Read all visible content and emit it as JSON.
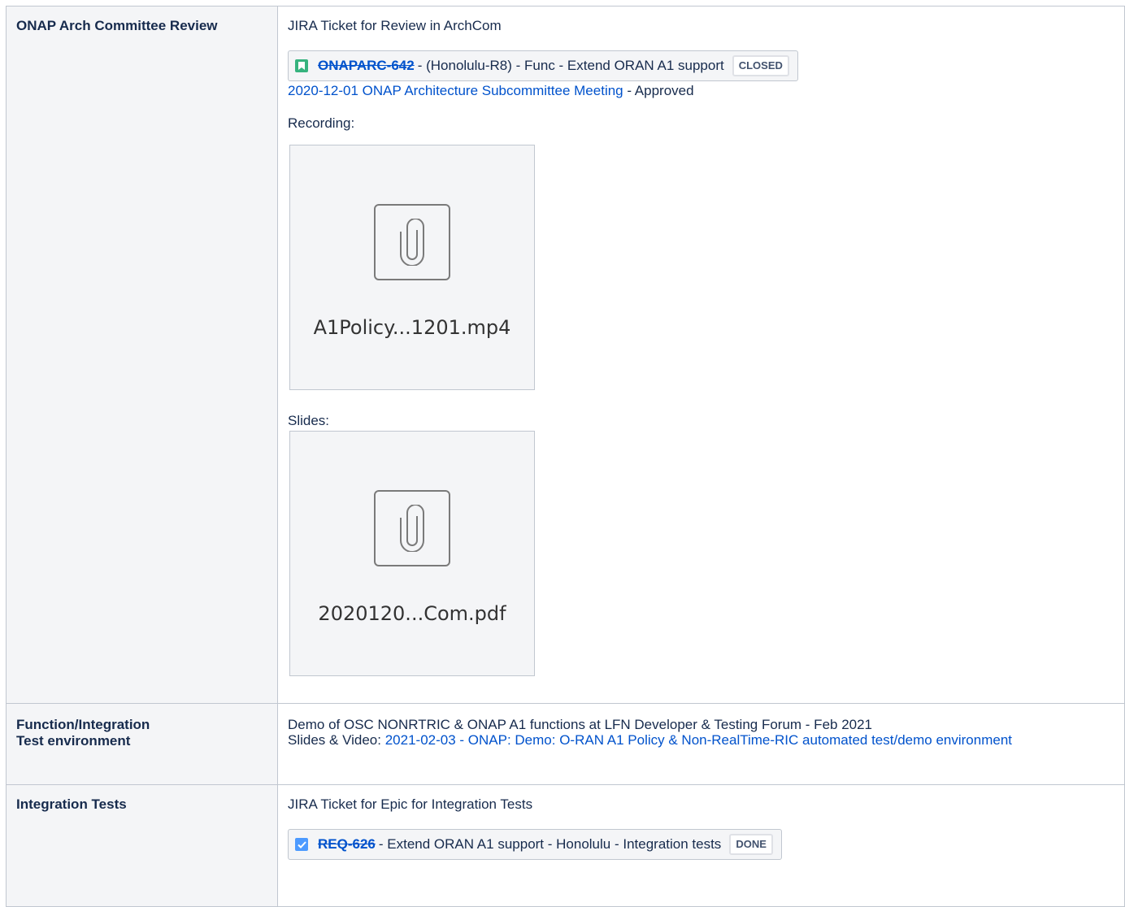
{
  "rows": [
    {
      "label": "ONAP Arch Committee Review",
      "intro": "JIRA Ticket for Review in ArchCom",
      "ticket": {
        "key": "ONAPARC-642",
        "summary": "- (Honolulu-R8) - Func - Extend ORAN A1 support",
        "status": "CLOSED",
        "type_icon": "story-icon",
        "type_color": "#36b37e"
      },
      "meeting_link": "2020-12-01 ONAP Architecture Subcommittee Meeting",
      "meeting_suffix": " - Approved",
      "recording_label": "Recording:",
      "recording_file": "A1Policy...1201.mp4",
      "slides_label": "Slides:",
      "slides_file": "2020120...Com.pdf"
    },
    {
      "label_line1": "Function/Integration",
      "label_line2": "Test environment",
      "demo_text": "Demo of OSC NONRTRIC & ONAP A1 functions at LFN Developer & Testing Forum - Feb 2021",
      "slides_prefix": "Slides & Video: ",
      "slides_link": "2021-02-03 - ONAP: Demo: O-RAN A1 Policy & Non-RealTime-RIC automated test/demo environment"
    },
    {
      "label": "Integration Tests",
      "intro": "JIRA Ticket for Epic for Integration Tests",
      "ticket": {
        "key": "REQ-626",
        "summary": "- Extend ORAN A1 support - Honolulu - Integration tests",
        "status": "DONE",
        "type_icon": "task-checkbox-icon",
        "type_color": "#4c9aff"
      }
    }
  ],
  "colors": {
    "link": "#0052cc",
    "header_bg": "#f4f5f7",
    "border": "#c1c7d0"
  }
}
